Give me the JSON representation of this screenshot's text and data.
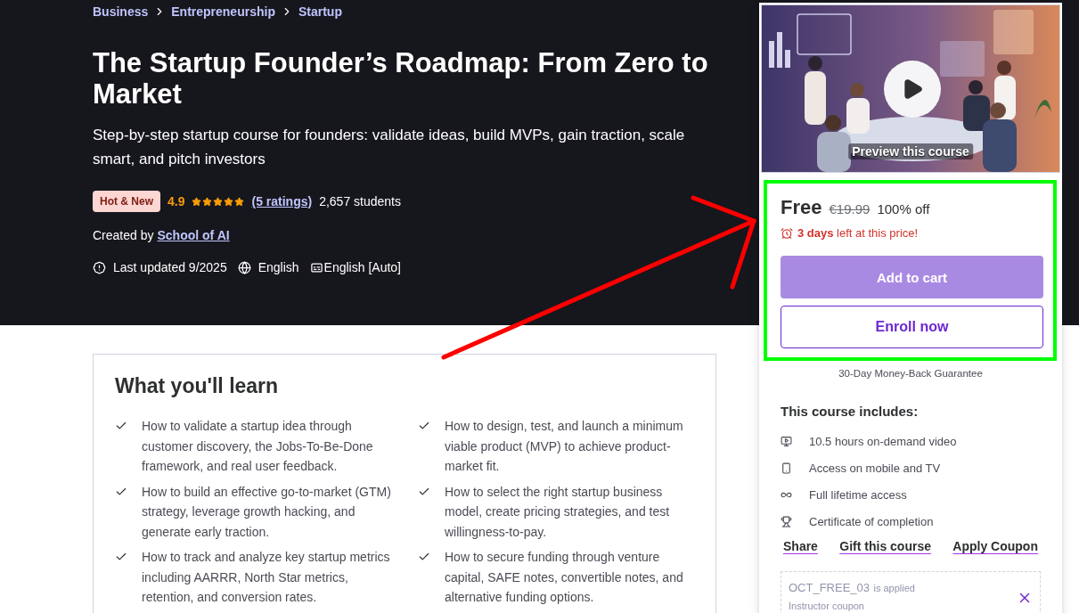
{
  "breadcrumb": [
    "Business",
    "Entrepreneurship",
    "Startup"
  ],
  "title": "The Startup Founder’s Roadmap: From Zero to Market",
  "subtitle": "Step-by-step startup course for founders: validate ideas, build MVPs, gain traction, scale smart, and pitch investors",
  "badge": "Hot & New",
  "rating": "4.9",
  "stars": 5,
  "ratings_link": "(5 ratings)",
  "students": "2,657 students",
  "created_by": {
    "label": "Created by",
    "instructor": "School of AI"
  },
  "meta": [
    {
      "kind": "updated",
      "text": "Last updated 9/2025"
    },
    {
      "kind": "language",
      "text": "English"
    },
    {
      "kind": "captions",
      "text": "English [Auto]"
    }
  ],
  "preview": {
    "kind": "picture",
    "caption": "Preview this course"
  },
  "price": {
    "current": "Free",
    "original": "€19.99",
    "discount": "100% off",
    "timer": "**3 days** left at this price!"
  },
  "add_to_cart": {
    "label": "Add to cart",
    "disabled": true
  },
  "enroll": {
    "label": "Enroll now"
  },
  "guarantee": "30-Day Money-Back Guarantee",
  "includes": {
    "title": "This course includes:",
    "items": [
      {
        "kind": "video",
        "text": "10.5 hours on-demand video"
      },
      {
        "kind": "mobile",
        "text": "Access on mobile and TV"
      },
      {
        "kind": "lifetime",
        "text": "Full lifetime access"
      },
      {
        "kind": "certificate",
        "text": "Certificate of completion"
      }
    ]
  },
  "actions": [
    "Share",
    "Gift this course",
    "Apply Coupon"
  ],
  "coupon": {
    "code": "OCT_FREE_03",
    "note": "is applied",
    "subtitle": "Instructor coupon"
  },
  "learn": {
    "title": "What you'll learn",
    "items": [
      "How to validate a startup idea through customer discovery, the Jobs-To-Be-Done framework, and real user feedback.",
      "How to design, test, and launch a minimum viable product (MVP) to achieve product-market fit.",
      "How to build an effective go-to-market (GTM) strategy, leverage growth hacking, and generate early traction.",
      "How to select the right startup business model, create pricing strategies, and test willingness-to-pay.",
      "How to track and analyze key startup metrics including AARRR, North Star metrics, retention, and conversion rates.",
      "How to secure funding through venture capital, SAFE notes, convertible notes, and alternative funding options."
    ]
  }
}
